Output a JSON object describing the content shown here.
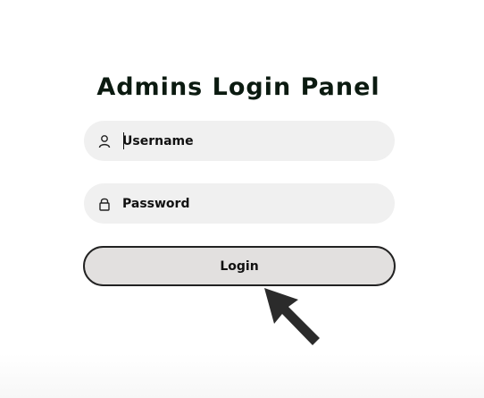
{
  "panel": {
    "title": "Admins Login Panel"
  },
  "form": {
    "username": {
      "placeholder": "Username",
      "value": "",
      "icon": "user-icon"
    },
    "password": {
      "placeholder": "Password",
      "value": "",
      "icon": "lock-icon"
    },
    "login_label": "Login"
  },
  "pointer": {
    "icon": "arrow-pointer-icon"
  },
  "colors": {
    "title": "#0b1a10",
    "field_bg": "#f0f0f0",
    "button_bg": "#e2e0df",
    "button_border": "#222222",
    "arrow": "#2b2b2b"
  }
}
